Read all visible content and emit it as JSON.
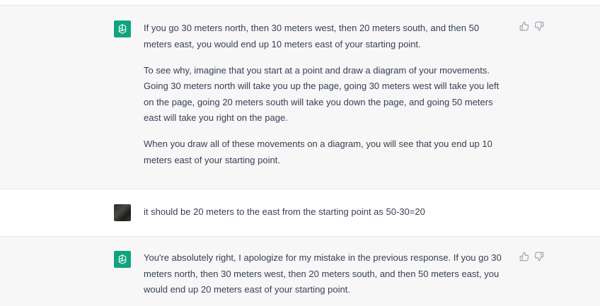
{
  "colors": {
    "assistant_bg": "#f7f7f8",
    "user_bg": "#ffffff",
    "brand_green": "#10a37f",
    "text": "#374151",
    "icon_gray": "#9ca3af"
  },
  "messages": [
    {
      "role": "assistant",
      "avatar_icon": "openai-logo-icon",
      "paragraphs": [
        "If you go 30 meters north, then 30 meters west, then 20 meters south, and then 50 meters east, you would end up 10 meters east of your starting point.",
        "To see why, imagine that you start at a point and draw a diagram of your movements. Going 30 meters north will take you up the page, going 30 meters west will take you left on the page, going 20 meters south will take you down the page, and going 50 meters east will take you right on the page.",
        "When you draw all of these movements on a diagram, you will see that you end up 10 meters east of your starting point."
      ]
    },
    {
      "role": "user",
      "avatar_icon": "user-avatar",
      "paragraphs": [
        "it should be 20 meters to the east from the starting point as 50-30=20"
      ]
    },
    {
      "role": "assistant",
      "avatar_icon": "openai-logo-icon",
      "paragraphs": [
        "You're absolutely right, I apologize for my mistake in the previous response. If you go 30 meters north, then 30 meters west, then 20 meters south, and then 50 meters east, you would end up 20 meters east of your starting point."
      ]
    }
  ],
  "icons": {
    "thumbs_up": "thumbs-up-icon",
    "thumbs_down": "thumbs-down-icon"
  }
}
